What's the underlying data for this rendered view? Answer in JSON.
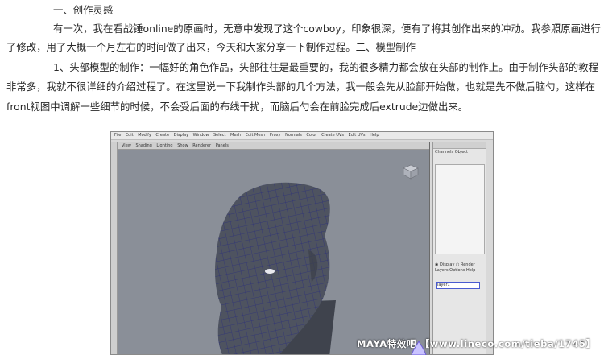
{
  "article": {
    "section1_heading": "一、创作灵感",
    "p1_line1": "有一次，我在看战锤online的原画时，无意中发现了这个cowboy，印象很深，便有了将其创作出来的冲动。我参照原画进行",
    "p1_line2": "了修改，用了大概一个月左右的时间做了出来，今天和大家分享一下制作过程。二、模型制作",
    "p2_line1": "1、头部模型的制作：一幅好的角色作品，头部往往是最重要的，我的很多精力都会放在头部的制作上。由于制作头部的教程",
    "p2_line2": "非常多，我就不很详细的介绍过程了。在这里说一下我制作头部的几个方法，我一般会先从脸部开始做，也就是先不做后脑勺，这样在",
    "p2_line3": "front视图中调解一些细节的时候，不会受后面的布线干扰，而脑后勺会在前脸完成后extrude边做出来。"
  },
  "screenshot": {
    "menu": [
      "File",
      "Edit",
      "Modify",
      "Create",
      "Display",
      "Window",
      "Select",
      "Mesh",
      "Edit Mesh",
      "Proxy",
      "Normals",
      "Color",
      "Create UVs",
      "Edit UVs",
      "Help"
    ],
    "view_menu": [
      "View",
      "Shading",
      "Lighting",
      "Show",
      "Renderer",
      "Panels"
    ],
    "channel_tabs": [
      "Channels",
      "Object"
    ],
    "layer_tabs": [
      "Display",
      "Render"
    ],
    "layer_menu": [
      "Layers",
      "Options",
      "Help"
    ],
    "layer_name": "layer1",
    "watermark": "MAYA特效吧 【www.lineco.com/tieba/1745】"
  },
  "colors": {
    "viewport_bg": "#8a8f98",
    "mesh_fill": "#4e5360",
    "wire": "#2c2f7a"
  }
}
